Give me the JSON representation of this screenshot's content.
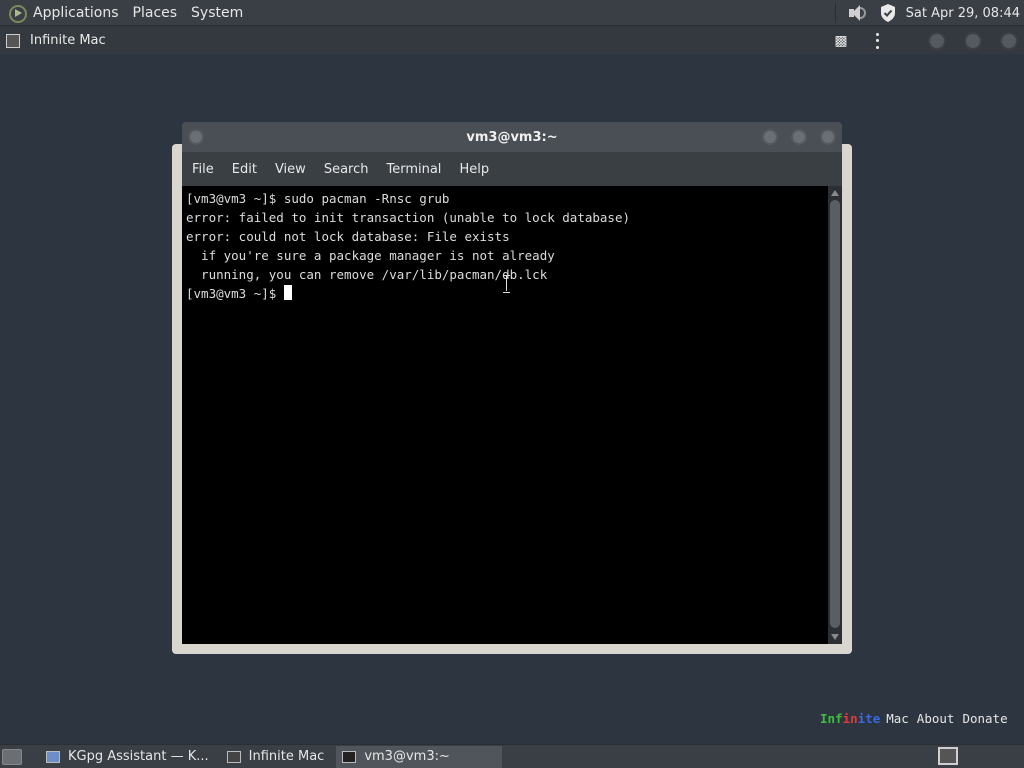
{
  "top_panel": {
    "menus": [
      "Applications",
      "Places",
      "System"
    ],
    "clock": "Sat Apr 29, 08:44"
  },
  "app_bar": {
    "title": "Infinite Mac"
  },
  "terminal": {
    "title": "vm3@vm3:~",
    "menu": [
      "File",
      "Edit",
      "View",
      "Search",
      "Terminal",
      "Help"
    ],
    "lines": [
      "[vm3@vm3 ~]$ sudo pacman -Rnsc grub",
      "error: failed to init transaction (unable to lock database)",
      "error: could not lock database: File exists",
      "  if you're sure a package manager is not already",
      "  running, you can remove /var/lib/pacman/db.lck"
    ],
    "prompt": "[vm3@vm3 ~]$ "
  },
  "branding": {
    "logo_parts": [
      "Inf",
      "in",
      "ite"
    ],
    "logo_suffix": "Mac",
    "links": [
      "About",
      "Donate"
    ]
  },
  "taskbar": {
    "tasks": [
      "KGpg Assistant — K...",
      "Infinite Mac",
      "vm3@vm3:~"
    ]
  },
  "colors": {
    "desktop": "#2d3540",
    "terminal_bg": "#000000",
    "terminal_text": "#dcdcdc"
  }
}
